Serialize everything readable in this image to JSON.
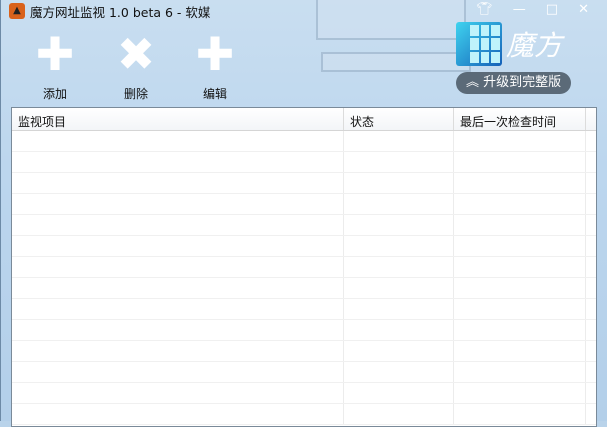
{
  "window": {
    "title": "魔方网址监视 1.0 beta 6 - 软媒"
  },
  "toolbar": {
    "add": "添加",
    "delete": "删除",
    "edit": "编辑"
  },
  "brand": {
    "name": "魔方",
    "upgrade": "升级到完整版"
  },
  "table": {
    "columns": [
      "监视项目",
      "状态",
      "最后一次检查时间"
    ],
    "rows": []
  }
}
